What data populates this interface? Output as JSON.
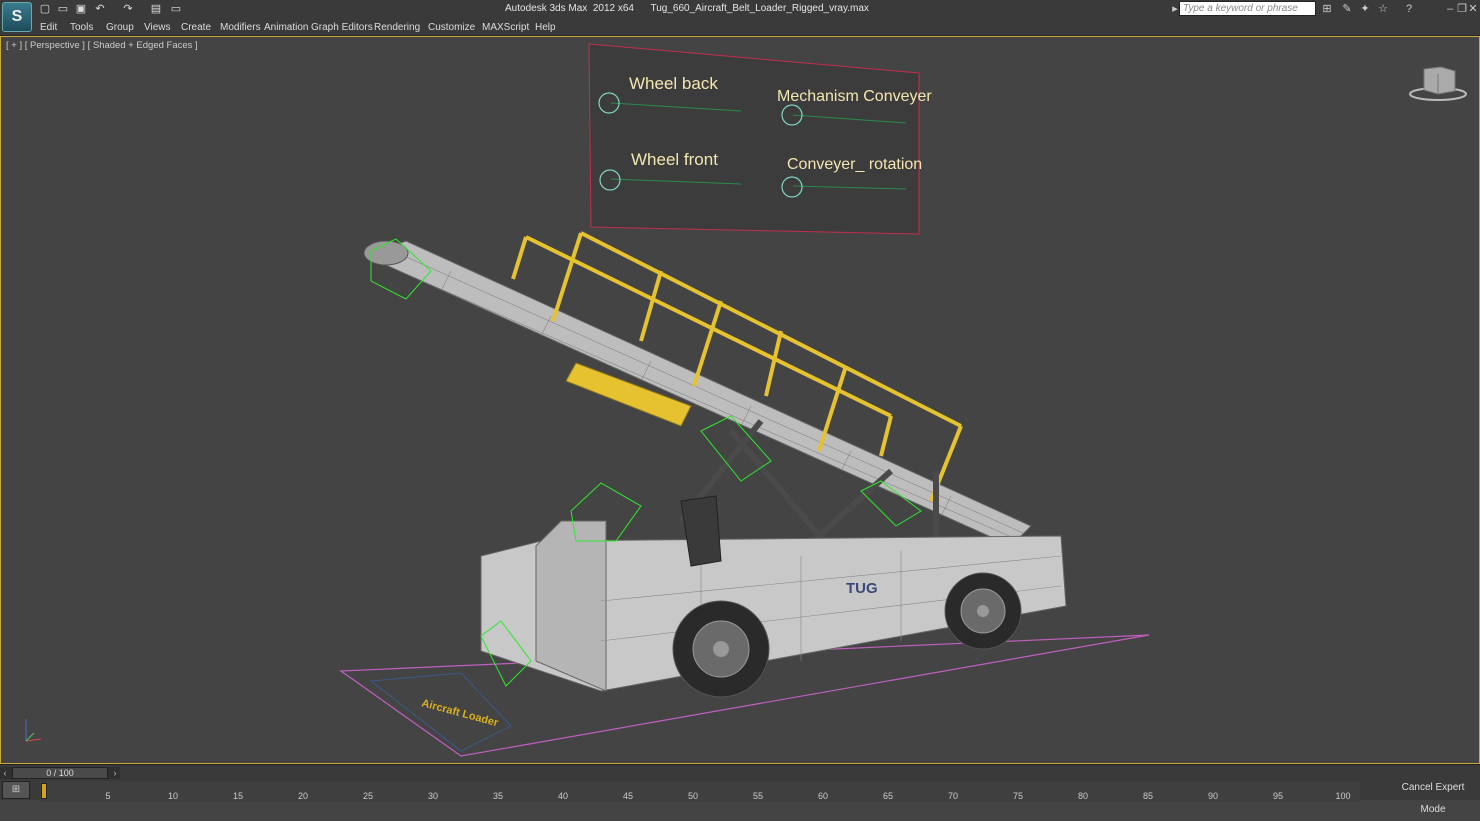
{
  "titlebar": {
    "app_logo": "S",
    "title": "Autodesk 3ds Max  2012 x64      Tug_660_Aircraft_Belt_Loader_Rigged_vray.max",
    "search_placeholder": "Type a keyword or phrase"
  },
  "menubar": {
    "items": [
      "Edit",
      "Tools",
      "Group",
      "Views",
      "Create",
      "Modifiers",
      "Animation",
      "Graph Editors",
      "Rendering",
      "Customize",
      "MAXScript",
      "Help"
    ]
  },
  "viewport": {
    "label": "[ + ] [ Perspective ] [ Shaded + Edged Faces ]",
    "rig_panel": {
      "controls": [
        "Wheel back",
        "Mechanism Conveyer",
        "Wheel front",
        "Conveyer_ rotation"
      ]
    },
    "truck_logo": "TUG",
    "ground_text": "Aircraft Loader"
  },
  "timeline": {
    "slider_value": "0 / 100",
    "ticks": [
      "5",
      "10",
      "15",
      "20",
      "25",
      "30",
      "35",
      "40",
      "45",
      "50",
      "55",
      "60",
      "65",
      "70",
      "75",
      "80",
      "85",
      "90",
      "95",
      "100"
    ],
    "expert_mode": "Cancel Expert Mode"
  },
  "colors": {
    "accent": "#c9a93a",
    "ui_bg": "#3a3a3a",
    "viewport_bg": "#444444",
    "rig_border": "#c0304a",
    "rig_text": "#f4e6b0",
    "rig_circle": "#7fd6c4",
    "gizmo_green": "#2ee82e",
    "railing_yellow": "#e6c230"
  }
}
